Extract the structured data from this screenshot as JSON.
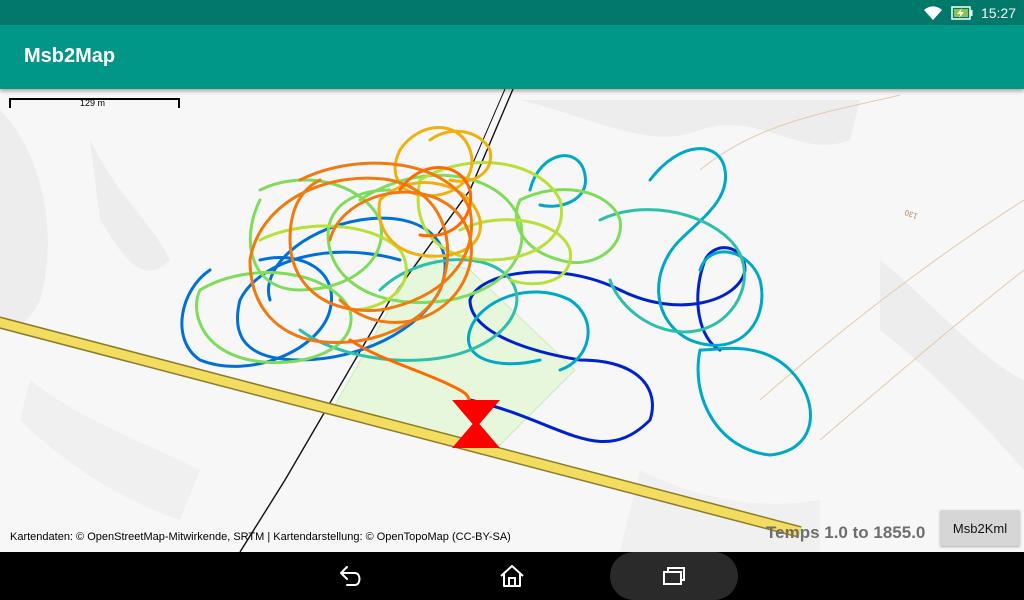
{
  "status_bar": {
    "time": "15:27",
    "icons": [
      "wifi-icon",
      "battery-charging-icon"
    ]
  },
  "app_bar": {
    "title": "Msb2Map"
  },
  "map": {
    "scale_label": "129 m",
    "contour_label": "130",
    "attribution": "Kartendaten: © OpenStreetMap-Mitwirkende, SRTM | Kartendarstellung: © OpenTopoMap (CC-BY-SA)",
    "time_range": "Temps 1.0 to 1855.0",
    "kml_button": "Msb2Kml",
    "track_colors": [
      "#0022cc",
      "#0070d8",
      "#00a8c8",
      "#2cc0a8",
      "#7fdc5a",
      "#b8e03a",
      "#f0b010",
      "#f07a10",
      "#ff6a00"
    ],
    "marker_color": "#ff0000"
  },
  "nav_bar": {
    "icons": [
      "back-icon",
      "home-icon",
      "recents-icon"
    ]
  }
}
